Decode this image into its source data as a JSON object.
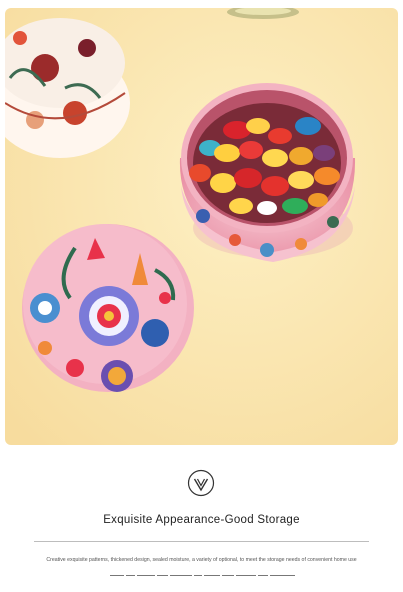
{
  "hero": {
    "icon": "checkmark-v-badge-icon"
  },
  "headline": "Exquisite Appearance-Good Storage",
  "description": "Creative exquisite patterns, thickened design, sealed moisture, a variety of optional, to meet the storage needs of convenient home use",
  "colors": {
    "background": "#ffffff",
    "photo_cream": "#fbe7b0",
    "tin_pink": "#f5b8c6",
    "headline_text": "#222222",
    "divider": "#bdbdbd"
  }
}
